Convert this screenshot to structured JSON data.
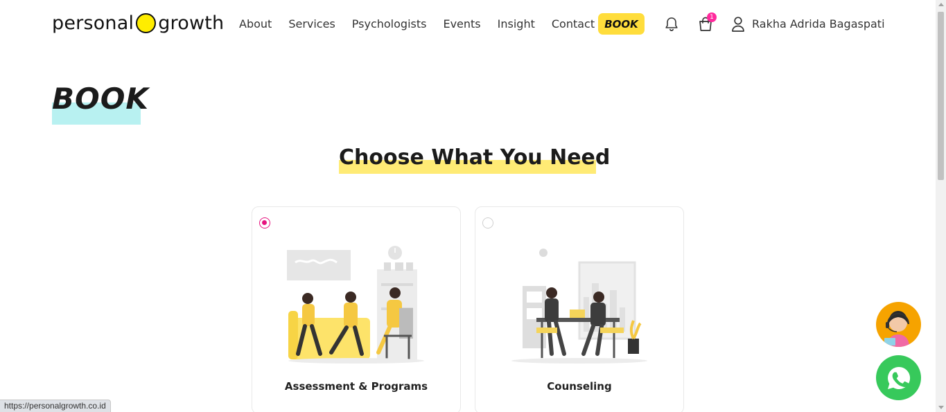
{
  "header": {
    "logo_left": "personal",
    "logo_right": "growth",
    "nav": [
      "About",
      "Services",
      "Psychologists",
      "Events",
      "Insight",
      "Contact"
    ],
    "book_label": "BOOK",
    "cart_count": "1",
    "user_name": "Rakha Adrida Bagaspati"
  },
  "page": {
    "title": "BOOK",
    "section_heading": "Choose What You Need"
  },
  "options": [
    {
      "label": "Assessment & Programs",
      "selected": true
    },
    {
      "label": "Counseling",
      "selected": false
    }
  ],
  "status_bar": {
    "url": "https://personalgrowth.co.id"
  },
  "colors": {
    "accent_yellow": "#ffdd3c",
    "heading_highlight": "#ffeb75",
    "title_highlight": "#b8f1f1",
    "radio_selected": "#e6137f",
    "badge": "#ff2a9d",
    "whatsapp": "#37c95b",
    "agent_bg": "#f6a300"
  },
  "icons": [
    "bell-icon",
    "cart-icon",
    "user-icon",
    "whatsapp-icon",
    "support-agent-icon"
  ]
}
